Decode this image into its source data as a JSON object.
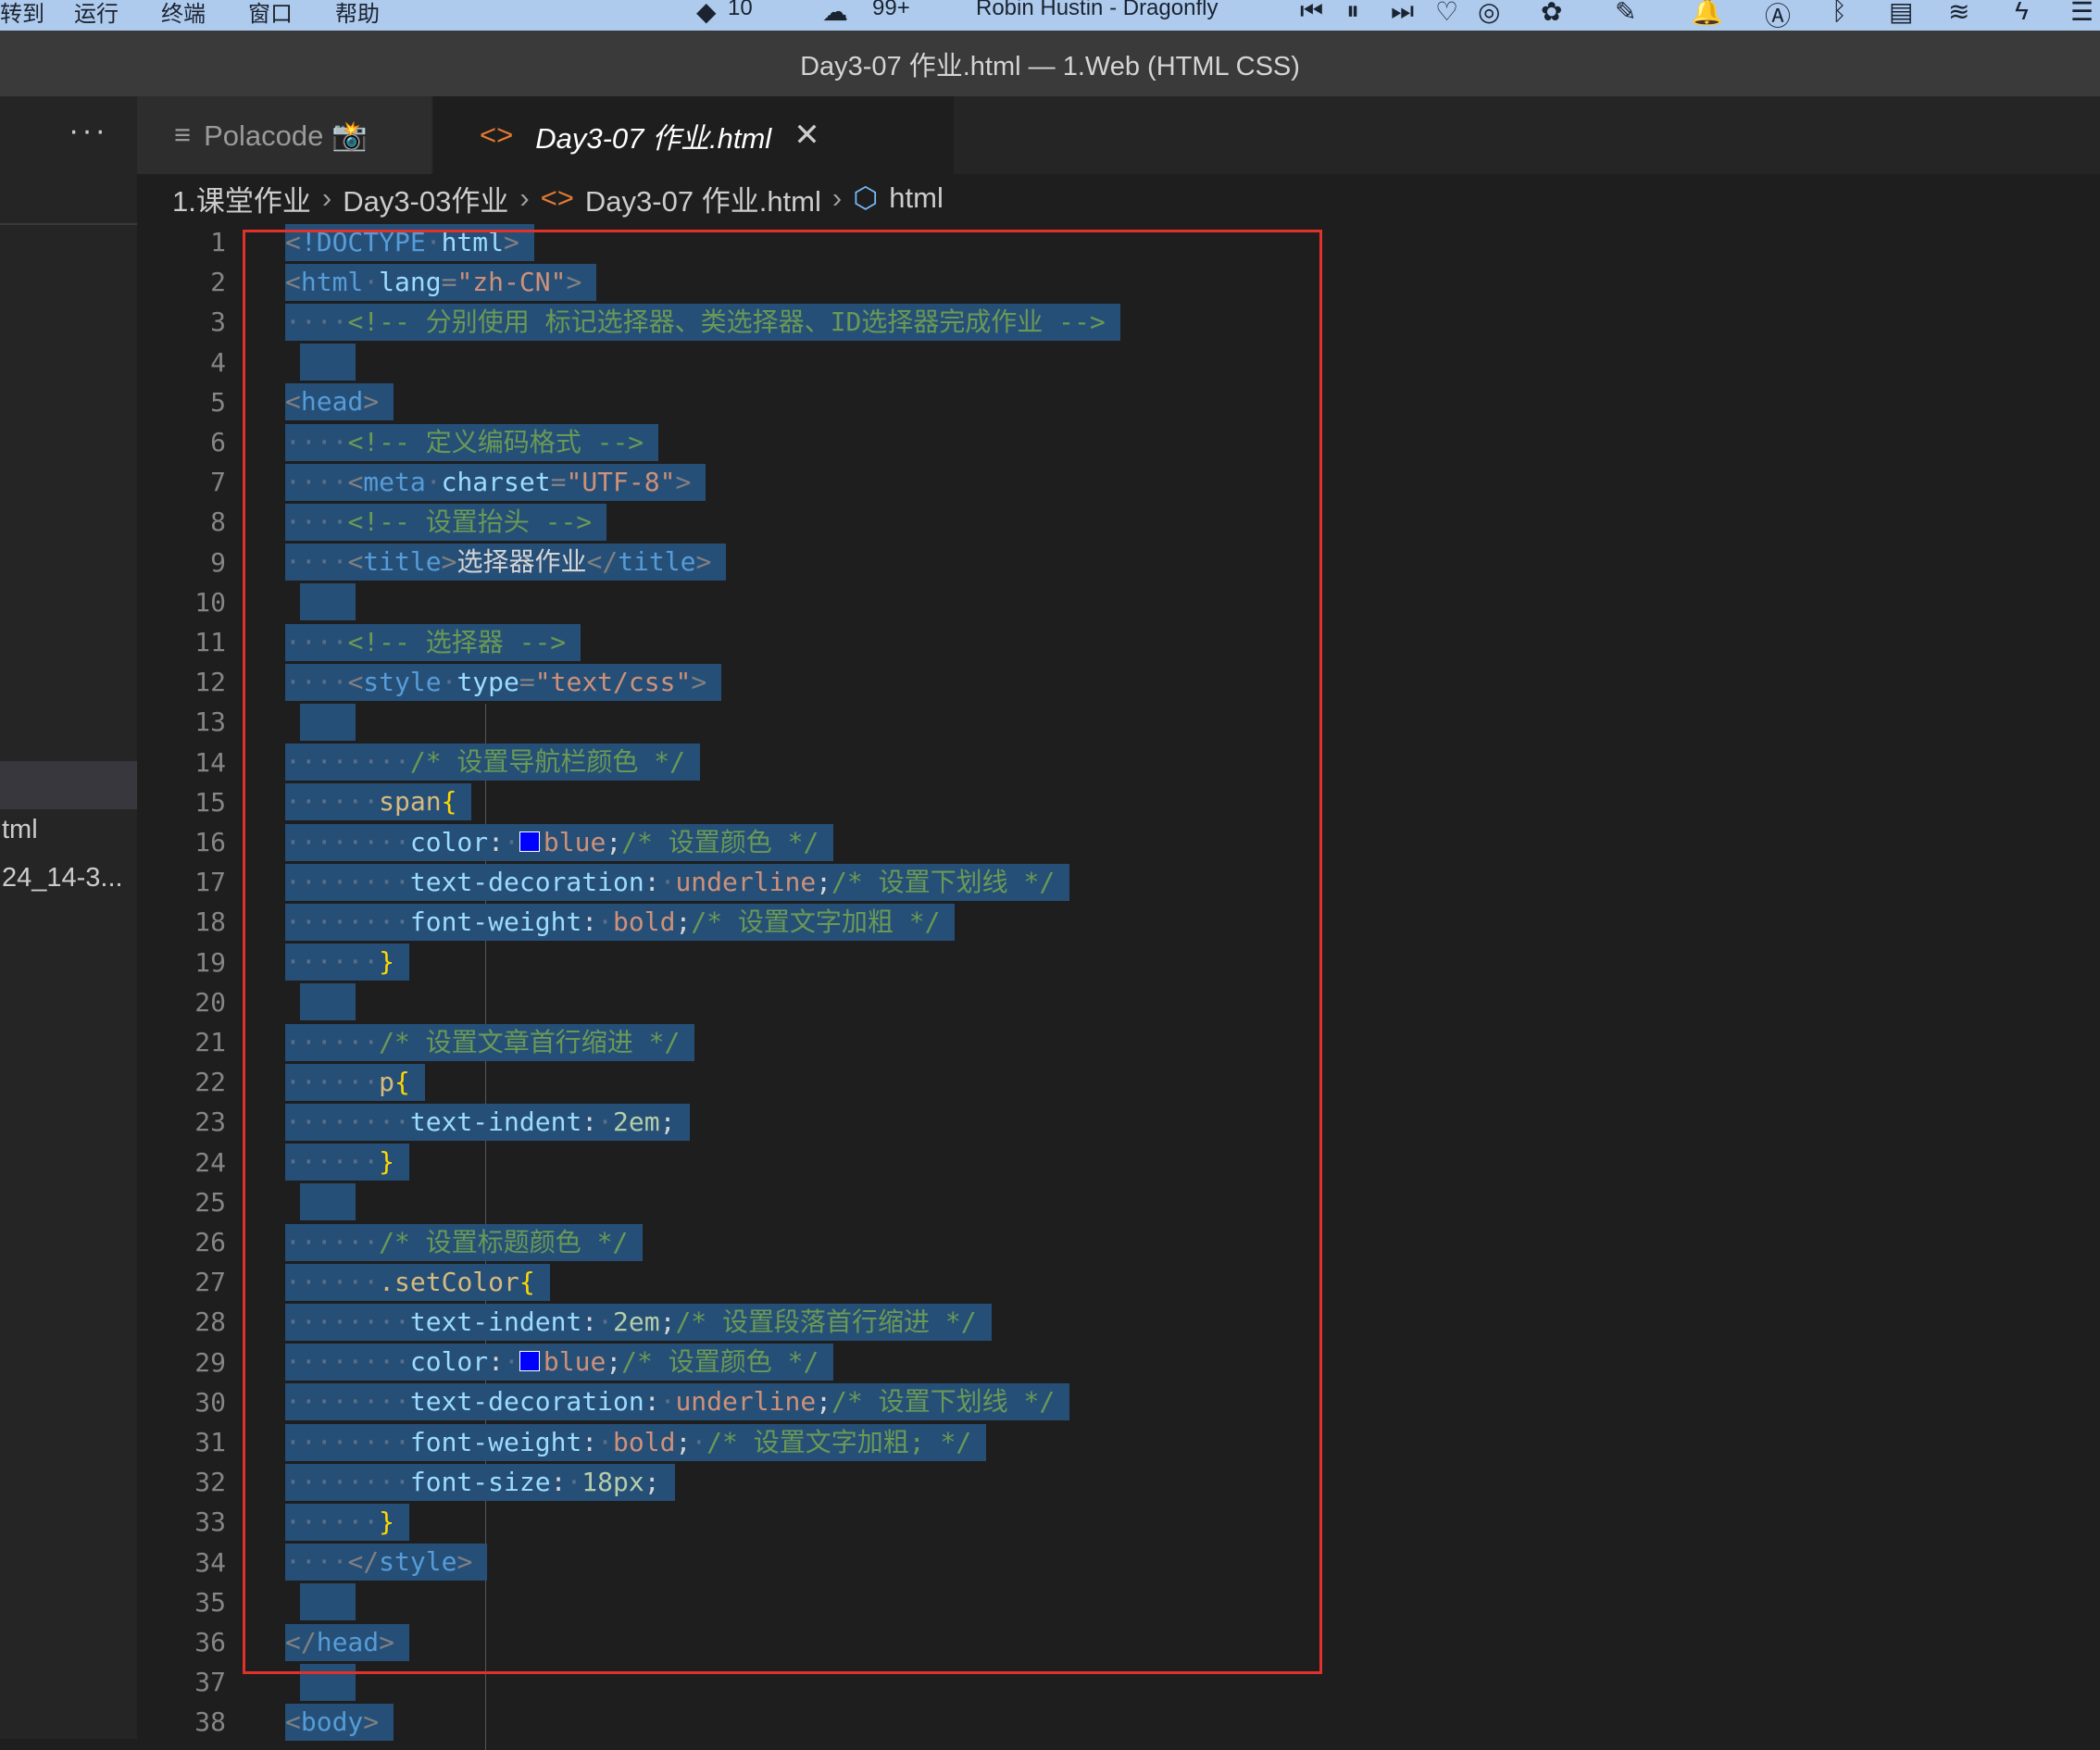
{
  "menubar": {
    "items": [
      "转到",
      "运行",
      "终端",
      "窗口",
      "帮助"
    ],
    "badge1": "10",
    "badge2": "99+",
    "now_playing": "Robin Hustin - Dragonfly"
  },
  "window": {
    "title": "Day3-07 作业.html — 1.Web (HTML CSS)"
  },
  "sidebar": {
    "more": "···",
    "files": [
      "tml",
      "24_14-3..."
    ]
  },
  "tabs": [
    {
      "label": "Polacode 📸",
      "icon": "list-icon",
      "active": false
    },
    {
      "label": "Day3-07 作业.html",
      "icon": "code-icon",
      "active": true
    }
  ],
  "breadcrumb": [
    "1.课堂作业",
    "Day3-03作业",
    "Day3-07 作业.html",
    "html"
  ],
  "editor": {
    "lines": [
      "<!DOCTYPE html>",
      "<html lang=\"zh-CN\">",
      "    <!-- 分别使用 标记选择器、类选择器、ID选择器完成作业 -->",
      "",
      "<head>",
      "    <!-- 定义编码格式 -->",
      "    <meta charset=\"UTF-8\">",
      "    <!-- 设置抬头 -->",
      "    <title>选择器作业</title>",
      "",
      "    <!-- 选择器 -->",
      "    <style type=\"text/css\">",
      "",
      "        /* 设置导航栏颜色 */",
      "      span{",
      "        color: blue;/* 设置颜色 */",
      "        text-decoration: underline;/* 设置下划线 */",
      "        font-weight: bold;/* 设置文字加粗 */",
      "      }",
      "",
      "      /* 设置文章首行缩进 */",
      "      p{",
      "        text-indent: 2em;",
      "      }",
      "",
      "      /* 设置标题颜色 */",
      "      .setColor{",
      "        text-indent: 2em;/* 设置段落首行缩进 */",
      "        color: blue;/* 设置颜色 */",
      "        text-decoration: underline;/* 设置下划线 */",
      "        font-weight: bold; /* 设置文字加粗; */",
      "        font-size: 18px;",
      "      }",
      "    </style>",
      "",
      "</head>",
      "",
      "<body>"
    ]
  },
  "colors": {
    "selection": "#264f78",
    "annotation": "#e0312b",
    "swatch": "#0000ff"
  }
}
